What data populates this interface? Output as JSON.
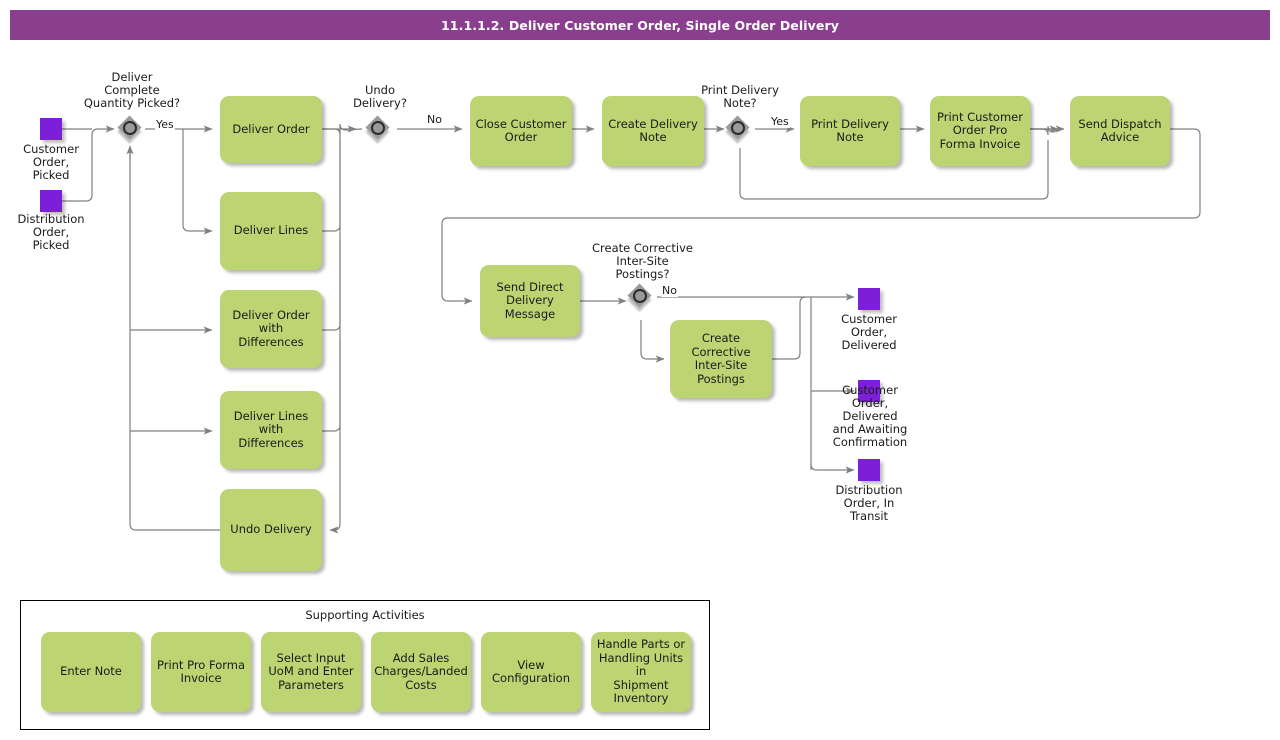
{
  "header": {
    "title": "11.1.1.2. Deliver Customer Order, Single Order Delivery",
    "bar_color": "#8a3f8e",
    "text_color": "#ffffff"
  },
  "theme": {
    "task_fill": "#bdd472",
    "event_fill": "#7d1fd8",
    "gateway_fill": "#9a9a9a",
    "connector": "#808080",
    "panel_border": "#000000"
  },
  "start_events": [
    {
      "name": "customer-order-picked",
      "label": "Customer\nOrder,\nPicked"
    },
    {
      "name": "distribution-order-picked",
      "label": "Distribution\nOrder,\nPicked"
    }
  ],
  "end_events": [
    {
      "name": "customer-order-delivered",
      "label": "Customer\nOrder,\nDelivered"
    },
    {
      "name": "customer-order-delivered-awaiting-confirmation",
      "label": "Customer\nOrder,\nDelivered\nand Awaiting\nConfirmation"
    },
    {
      "name": "distribution-order-in-transit",
      "label": "Distribution\nOrder, In\nTransit"
    }
  ],
  "gateways": [
    {
      "name": "deliver-complete-quantity-picked",
      "label": "Deliver\nComplete\nQuantity Picked?",
      "branch_label": "Yes"
    },
    {
      "name": "undo-delivery",
      "label": "Undo\nDelivery?",
      "branch_label": "No"
    },
    {
      "name": "print-delivery-note",
      "label": "Print Delivery\nNote?",
      "branch_label": "Yes"
    },
    {
      "name": "create-corrective-inter-site-postings",
      "label": "Create Corrective\nInter-Site\nPostings?",
      "branch_label": "No"
    }
  ],
  "tasks": [
    {
      "name": "deliver-order",
      "label": "Deliver Order"
    },
    {
      "name": "deliver-lines",
      "label": "Deliver Lines"
    },
    {
      "name": "deliver-order-with-differences",
      "label": "Deliver Order\nwith Differences"
    },
    {
      "name": "deliver-lines-with-differences",
      "label": "Deliver Lines\nwith Differences"
    },
    {
      "name": "undo-delivery",
      "label": "Undo Delivery"
    },
    {
      "name": "close-customer-order",
      "label": "Close Customer\nOrder"
    },
    {
      "name": "create-delivery-note",
      "label": "Create Delivery\nNote"
    },
    {
      "name": "print-delivery-note",
      "label": "Print Delivery\nNote"
    },
    {
      "name": "print-customer-order-pro-forma-invoice",
      "label": "Print Customer\nOrder Pro\nForma Invoice"
    },
    {
      "name": "send-dispatch-advice",
      "label": "Send Dispatch\nAdvice"
    },
    {
      "name": "send-direct-delivery-message",
      "label": "Send Direct\nDelivery\nMessage"
    },
    {
      "name": "create-corrective-inter-site-postings",
      "label": "Create\nCorrective\nInter-Site\nPostings"
    }
  ],
  "supporting": {
    "title": "Supporting Activities",
    "items": [
      {
        "name": "enter-note",
        "label": "Enter Note"
      },
      {
        "name": "print-pro-forma-invoice",
        "label": "Print Pro Forma\nInvoice"
      },
      {
        "name": "select-input-uom-and-enter-parameters",
        "label": "Select Input\nUoM and Enter\nParameters"
      },
      {
        "name": "add-sales-charges-landed-costs",
        "label": "Add Sales\nCharges/Landed\nCosts"
      },
      {
        "name": "view-configuration",
        "label": "View\nConfiguration"
      },
      {
        "name": "handle-parts-or-handling-units-in-shipment-inventory",
        "label": "Handle Parts or\nHandling Units in\nShipment\nInventory"
      }
    ]
  }
}
